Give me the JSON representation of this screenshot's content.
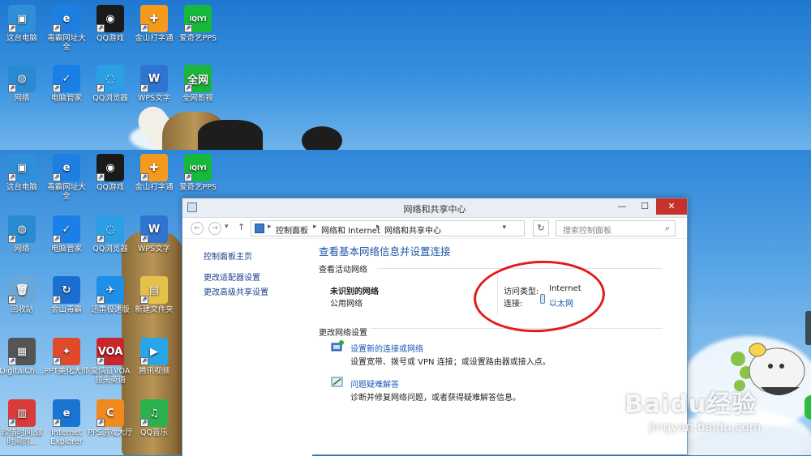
{
  "desktop_top": [
    {
      "label": "这台电脑",
      "color": "#2f8fd8",
      "glyph": "▣"
    },
    {
      "label": "毒霸网址大全",
      "color": "#1d7fe0",
      "glyph": "e"
    },
    {
      "label": "QQ游戏",
      "color": "#1a1a1a",
      "glyph": "◉"
    },
    {
      "label": "金山打字通",
      "color": "#f59a1c",
      "glyph": "✚"
    },
    {
      "label": "爱奇艺PPS",
      "color": "#16b93b",
      "glyph": "iQIYI"
    },
    {
      "label": "网络",
      "color": "#2a8ad2",
      "glyph": "◍"
    },
    {
      "label": "电脑管家",
      "color": "#1a7fe6",
      "glyph": "✓"
    },
    {
      "label": "QQ浏览器",
      "color": "#2a9fe6",
      "glyph": "◌"
    },
    {
      "label": "WPS文字",
      "color": "#2f74d0",
      "glyph": "W"
    },
    {
      "label": "全网影视",
      "color": "#19b53c",
      "glyph": "全网"
    }
  ],
  "desktop_bottom": [
    {
      "label": "这台电脑",
      "color": "#2f8fd8",
      "glyph": "▣"
    },
    {
      "label": "毒霸网址大全",
      "color": "#1d7fe0",
      "glyph": "e"
    },
    {
      "label": "QQ游戏",
      "color": "#1a1a1a",
      "glyph": "◉"
    },
    {
      "label": "金山打字通",
      "color": "#f59a1c",
      "glyph": "✚"
    },
    {
      "label": "爱奇艺PPS",
      "color": "#16b93b",
      "glyph": "iQIYI"
    },
    {
      "label": "网络",
      "color": "#2a8ad2",
      "glyph": "◍"
    },
    {
      "label": "电脑管家",
      "color": "#1a7fe6",
      "glyph": "✓"
    },
    {
      "label": "QQ浏览器",
      "color": "#2a9fe6",
      "glyph": "◌"
    },
    {
      "label": "WPS文字",
      "color": "#2f74d0",
      "glyph": "W"
    },
    {
      "label": "回收站",
      "color": "#6aa8d8",
      "glyph": "🗑"
    },
    {
      "label": "金山毒霸",
      "color": "#1b6fd0",
      "glyph": "↻"
    },
    {
      "label": "迅雷极速版",
      "color": "#1e8ee6",
      "glyph": "✈"
    },
    {
      "label": "新建文件夹",
      "color": "#e6c14a",
      "glyph": "▤"
    },
    {
      "label": "DigitalChi...",
      "color": "#555555",
      "glyph": "▦"
    },
    {
      "label": "PPT美化大师",
      "color": "#e04a2a",
      "glyph": "✦"
    },
    {
      "label": "爱情证VOA领头英语",
      "color": "#c8262a",
      "glyph": "VOA"
    },
    {
      "label": "腾讯视频",
      "color": "#27a6e8",
      "glyph": "▶"
    },
    {
      "label": "珍惜时间,做时间的...",
      "color": "#d93a3a",
      "glyph": "▥"
    },
    {
      "label": "Internet Explorer",
      "color": "#1a74d4",
      "glyph": "e"
    },
    {
      "label": "PPS游戏大厅",
      "color": "#f08a1e",
      "glyph": "C"
    },
    {
      "label": "QQ音乐",
      "color": "#2bb24c",
      "glyph": "♫"
    }
  ],
  "window": {
    "title": "网络和共享中心",
    "btn_min": "—",
    "btn_max": "☐",
    "btn_close": "✕",
    "back": "←",
    "forward": "→",
    "caret": "▾",
    "up": "↑",
    "breadcrumbs": [
      "控制面板",
      "网络和 Internet",
      "网络和共享中心"
    ],
    "breadcrumb_sep": "▸",
    "refresh": "↻",
    "search_placeholder": "搜索控制面板",
    "search_glyph": "⌕"
  },
  "sidebar": {
    "home": "控制面板主页",
    "links": [
      "更改适配器设置",
      "更改高级共享设置"
    ]
  },
  "main": {
    "heading": "查看基本网络信息并设置连接",
    "active_section": "查看活动网络",
    "network_name": "未识别的网络",
    "network_type": "公用网络",
    "access_label": "访问类型:",
    "access_value": "Internet",
    "conn_label": "连接:",
    "conn_value": "以太网",
    "change_section": "更改网络设置",
    "task1_title": "设置新的连接或网络",
    "task1_desc": "设置宽带、拨号或 VPN 连接；或设置路由器或接入点。",
    "task2_title": "问题疑难解答",
    "task2_desc": "诊断并修复网络问题，或者获得疑难解答信息。"
  },
  "watermark": {
    "brand": "Baidu经验",
    "url": "jingyan.baidu.com"
  },
  "colors": {
    "accent_link": "#1a58b8",
    "heading": "#1e57a8",
    "close_btn": "#c7312b",
    "annotation": "#e41b1b"
  }
}
